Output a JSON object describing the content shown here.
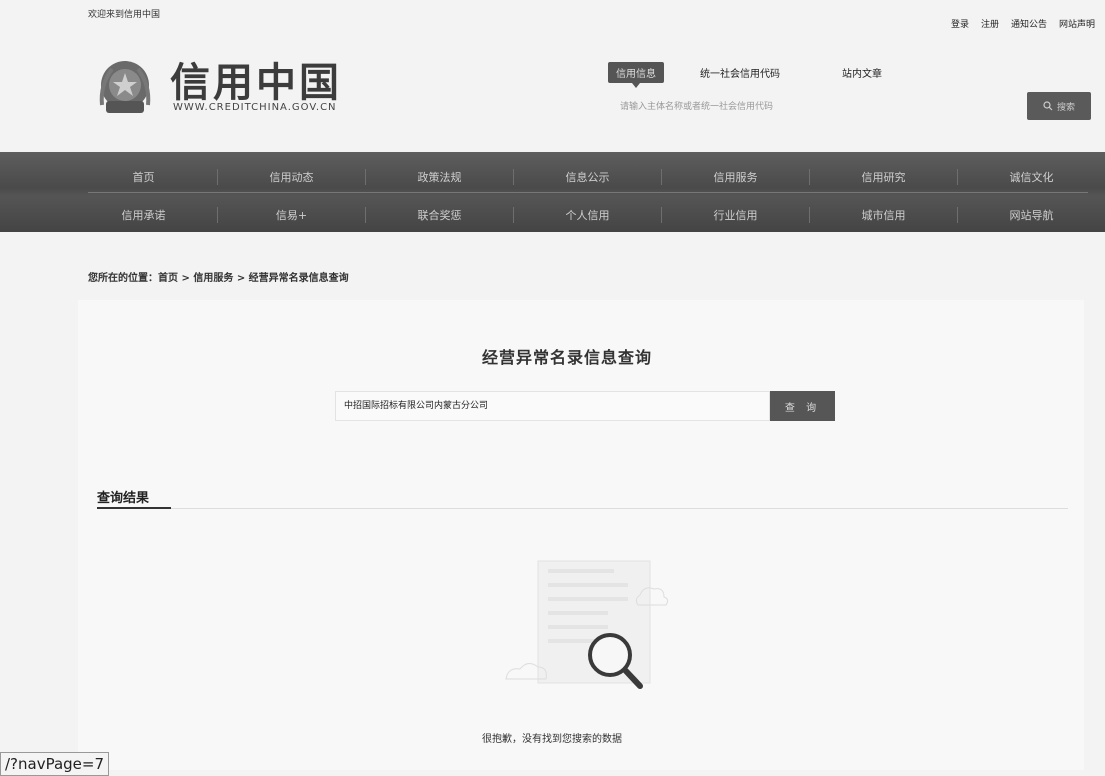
{
  "header": {
    "welcome": "欢迎来到信用中国",
    "top_links": [
      "登录",
      "注册",
      "通知公告",
      "网站声明"
    ]
  },
  "logo": {
    "title": "信用中国",
    "url": "WWW.CREDITCHINA.GOV.CN"
  },
  "search": {
    "tabs": [
      "信用信息",
      "统一社会信用代码",
      "站内文章"
    ],
    "active_tab": 0,
    "placeholder": "请输入主体名称或者统一社会信用代码",
    "button_label": "搜索"
  },
  "nav": {
    "row1": [
      "首页",
      "信用动态",
      "政策法规",
      "信息公示",
      "信用服务",
      "信用研究",
      "诚信文化"
    ],
    "row2": [
      "信用承诺",
      "信易+",
      "联合奖惩",
      "个人信用",
      "行业信用",
      "城市信用",
      "网站导航"
    ]
  },
  "breadcrumb": "您所在的位置：首页 > 信用服务 > 经营异常名录信息查询",
  "query": {
    "title": "经营异常名录信息查询",
    "input_value": "中招国际招标有限公司内蒙古分公司",
    "button_label": "查 询"
  },
  "results": {
    "title": "查询结果",
    "empty_message": "很抱歉，没有找到您搜索的数据"
  },
  "status_bar": {
    "url": "/?navPage=7"
  },
  "colors": {
    "nav_bg": "#4f4f4f",
    "button_bg": "#565656",
    "page_bg": "#f3f3f3"
  }
}
